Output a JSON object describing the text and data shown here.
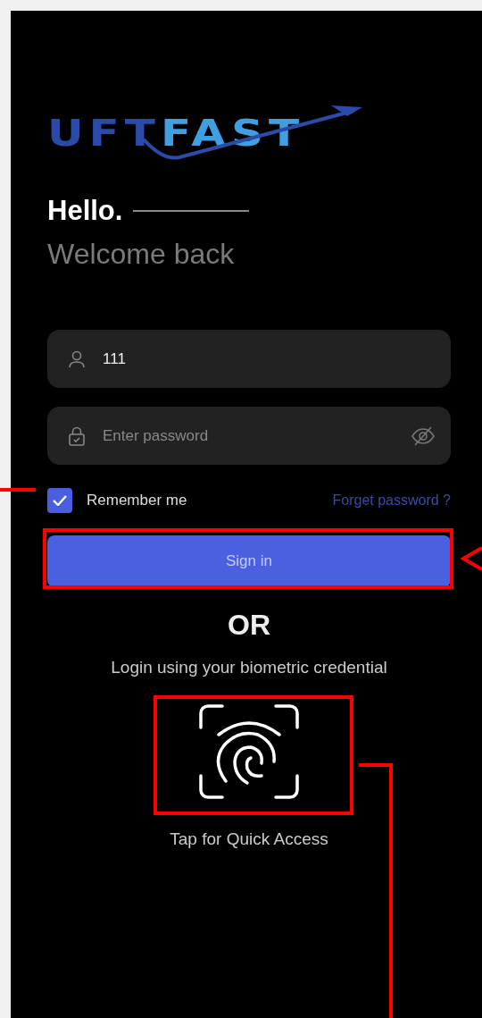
{
  "logo": {
    "parts": [
      {
        "text": "UFT",
        "color": "#2a4ca8"
      },
      {
        "text": "FAST",
        "color": "#3f9fe0"
      }
    ]
  },
  "greeting": {
    "title": "Hello.",
    "subtitle": "Welcome back"
  },
  "username": {
    "value": "111"
  },
  "password": {
    "placeholder": "Enter password"
  },
  "remember": {
    "label": "Remember me",
    "checked": true
  },
  "forgot_link": "Forget password ?",
  "sign_in_button": "Sign in",
  "divider_text": "OR",
  "biometric": {
    "prompt": "Login using your biometric credential",
    "hint": "Tap for Quick Access"
  }
}
